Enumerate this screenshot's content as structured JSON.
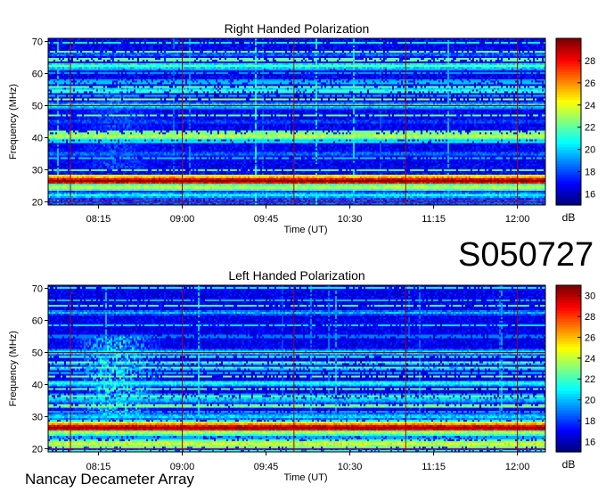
{
  "observation_id": "S050727",
  "instrument": "Nancay Decameter Array",
  "colors": {
    "band_strong": "#8b0000",
    "background": "#1020c8",
    "grid": "#b00000"
  },
  "chart_data": [
    {
      "type": "heatmap",
      "title": "Right Handed Polarization",
      "xlabel": "Time (UT)",
      "ylabel": "Frequency (MHz)",
      "x_ticks": [
        "08:15",
        "09:00",
        "09:45",
        "10:30",
        "11:15",
        "12:00"
      ],
      "x_tick_hours": [
        8.25,
        9.0,
        9.75,
        10.5,
        11.25,
        12.0
      ],
      "xlim_hours": [
        7.8,
        12.25
      ],
      "y_ticks": [
        20,
        30,
        40,
        50,
        60,
        70
      ],
      "ylim": [
        19,
        71
      ],
      "grid_time_hours": [
        8.0,
        9.0,
        10.0,
        11.0,
        12.0
      ],
      "grid_freq": [
        20,
        50
      ],
      "colorbar": {
        "label": "dB",
        "min": 15,
        "max": 30,
        "ticks": [
          16,
          18,
          20,
          22,
          24,
          26,
          28
        ]
      },
      "bands_mhz": [
        {
          "freq": 26.5,
          "level": 30
        },
        {
          "freq": 27.5,
          "level": 26
        },
        {
          "freq": 24.5,
          "level": 24
        },
        {
          "freq": 22.0,
          "level": 21
        },
        {
          "freq": 40.5,
          "level": 24
        },
        {
          "freq": 50.0,
          "level": 21
        },
        {
          "freq": 62.5,
          "level": 22
        },
        {
          "freq": 66.0,
          "level": 19
        },
        {
          "freq": 35.0,
          "level": 19
        },
        {
          "freq": 45.0,
          "level": 18.5
        }
      ]
    },
    {
      "type": "heatmap",
      "title": "Left Handed Polarization",
      "xlabel": "Time (UT)",
      "ylabel": "Frequency (MHz)",
      "x_ticks": [
        "08:15",
        "09:00",
        "09:45",
        "10:30",
        "11:15",
        "12:00"
      ],
      "x_tick_hours": [
        8.25,
        9.0,
        9.75,
        10.5,
        11.25,
        12.0
      ],
      "xlim_hours": [
        7.8,
        12.25
      ],
      "y_ticks": [
        20,
        30,
        40,
        50,
        60,
        70
      ],
      "ylim": [
        19,
        71
      ],
      "grid_time_hours": [
        8.0,
        9.0,
        10.0,
        11.0,
        12.0
      ],
      "grid_freq": [
        20,
        50
      ],
      "colorbar": {
        "label": "dB",
        "min": 15,
        "max": 31,
        "ticks": [
          16,
          18,
          20,
          22,
          24,
          26,
          28,
          30
        ]
      },
      "bands_mhz": [
        {
          "freq": 26.5,
          "level": 31
        },
        {
          "freq": 27.5,
          "level": 27
        },
        {
          "freq": 25.0,
          "level": 24
        },
        {
          "freq": 21.5,
          "level": 25
        },
        {
          "freq": 40.5,
          "level": 22
        },
        {
          "freq": 50.0,
          "level": 21
        },
        {
          "freq": 62.5,
          "level": 20
        },
        {
          "freq": 35.0,
          "level": 20
        },
        {
          "freq": 30.0,
          "level": 21
        }
      ]
    }
  ]
}
